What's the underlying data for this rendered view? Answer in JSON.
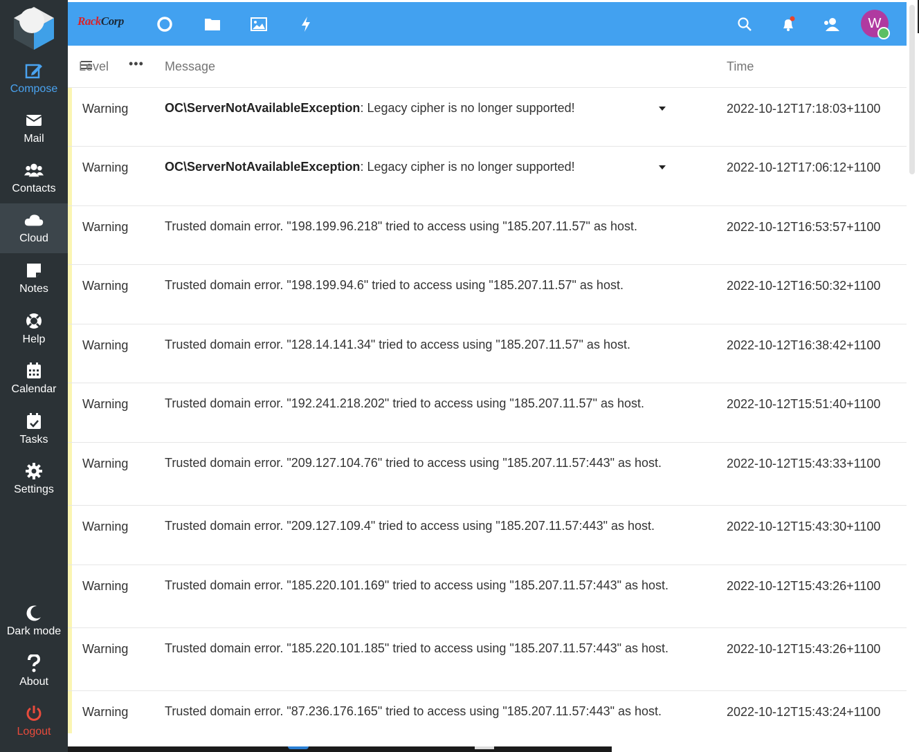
{
  "brand": {
    "part1": "Rack",
    "part2": "Corp"
  },
  "sidebar": {
    "items": [
      {
        "label": "Compose",
        "icon": "compose-icon"
      },
      {
        "label": "Mail",
        "icon": "envelope-icon"
      },
      {
        "label": "Contacts",
        "icon": "users-icon"
      },
      {
        "label": "Cloud",
        "icon": "cloud-icon"
      },
      {
        "label": "Notes",
        "icon": "note-icon"
      },
      {
        "label": "Help",
        "icon": "lifebuoy-icon"
      },
      {
        "label": "Calendar",
        "icon": "calendar-icon"
      },
      {
        "label": "Tasks",
        "icon": "calendar-check-icon"
      },
      {
        "label": "Settings",
        "icon": "gear-icon"
      }
    ],
    "bottom": [
      {
        "label": "Dark mode",
        "icon": "moon-icon"
      },
      {
        "label": "About",
        "icon": "question-icon"
      },
      {
        "label": "Logout",
        "icon": "power-icon"
      }
    ]
  },
  "topbar": {
    "avatar_initial": "W"
  },
  "table": {
    "headers": {
      "level": "Level",
      "message": "Message",
      "time": "Time"
    },
    "rows": [
      {
        "level": "Warning",
        "exception": "OC\\ServerNotAvailableException",
        "message": ": Legacy cipher is no longer supported!",
        "time": "2022-10-12T17:18:03+1100"
      },
      {
        "level": "Warning",
        "exception": "OC\\ServerNotAvailableException",
        "message": ": Legacy cipher is no longer supported!",
        "time": "2022-10-12T17:06:12+1100"
      },
      {
        "level": "Warning",
        "exception": "",
        "message": "Trusted domain error. \"198.199.96.218\" tried to access using \"185.207.11.57\" as host.",
        "time": "2022-10-12T16:53:57+1100"
      },
      {
        "level": "Warning",
        "exception": "",
        "message": "Trusted domain error. \"198.199.94.6\" tried to access using \"185.207.11.57\" as host.",
        "time": "2022-10-12T16:50:32+1100"
      },
      {
        "level": "Warning",
        "exception": "",
        "message": "Trusted domain error. \"128.14.141.34\" tried to access using \"185.207.11.57\" as host.",
        "time": "2022-10-12T16:38:42+1100"
      },
      {
        "level": "Warning",
        "exception": "",
        "message": "Trusted domain error. \"192.241.218.202\" tried to access using \"185.207.11.57\" as host.",
        "time": "2022-10-12T15:51:40+1100"
      },
      {
        "level": "Warning",
        "exception": "",
        "message": "Trusted domain error. \"209.127.104.76\" tried to access using \"185.207.11.57:443\" as host.",
        "time": "2022-10-12T15:43:33+1100"
      },
      {
        "level": "Warning",
        "exception": "",
        "message": "Trusted domain error. \"209.127.109.4\" tried to access using \"185.207.11.57:443\" as host.",
        "time": "2022-10-12T15:43:30+1100"
      },
      {
        "level": "Warning",
        "exception": "",
        "message": "Trusted domain error. \"185.220.101.169\" tried to access using \"185.207.11.57:443\" as host.",
        "time": "2022-10-12T15:43:26+1100"
      },
      {
        "level": "Warning",
        "exception": "",
        "message": "Trusted domain error. \"185.220.101.185\" tried to access using \"185.207.11.57:443\" as host.",
        "time": "2022-10-12T15:43:26+1100"
      },
      {
        "level": "Warning",
        "exception": "",
        "message": "Trusted domain error. \"87.236.176.165\" tried to access using \"185.207.11.57:443\" as host.",
        "time": "2022-10-12T15:43:24+1100"
      }
    ]
  },
  "colors": {
    "topbar": "#42a1f0",
    "sidebar": "#2b3236",
    "warning_stripe": "#fbf5b3",
    "avatar": "#b03aa0",
    "logout": "#e84b3c"
  }
}
